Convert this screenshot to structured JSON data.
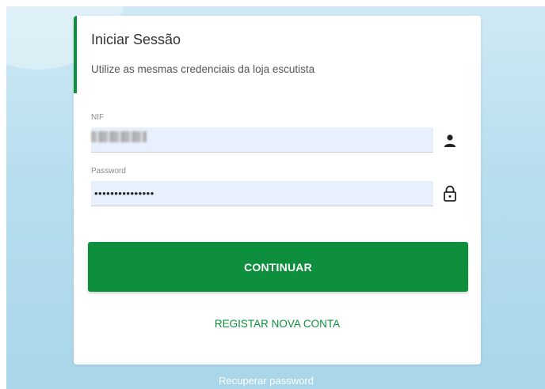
{
  "login": {
    "title": "Iniciar Sessão",
    "subtitle": "Utilize as mesmas credenciais da loja escutista",
    "nif": {
      "label": "NIF",
      "icon": "person-icon"
    },
    "password": {
      "label": "Password",
      "value": "•••••••••••••••",
      "icon": "lock-icon"
    },
    "continue_label": "CONTINUAR",
    "register_label": "REGISTAR NOVA CONTA",
    "recover_label": "Recuperar password"
  },
  "colors": {
    "accent": "#0e8f3e",
    "input_bg": "#e8f0fe",
    "background": "#b7deee"
  }
}
